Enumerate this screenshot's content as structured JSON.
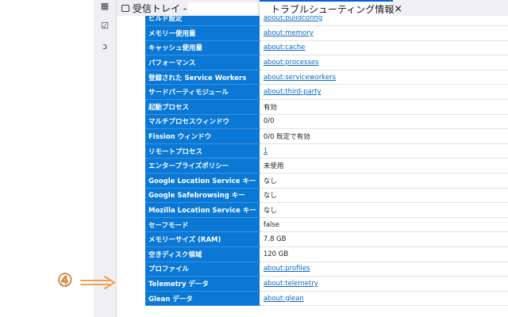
{
  "tabs": [
    {
      "title": "受信トレイ -",
      "icon": "mail-icon"
    },
    {
      "title": "トラブルシューティング情報",
      "icon": "firefox-icon",
      "close": "×"
    }
  ],
  "spaces_toolbar": [
    {
      "icon": "calendar-icon",
      "glyph": "▦"
    },
    {
      "icon": "tasks-icon",
      "glyph": "☑"
    },
    {
      "icon": "chat-icon",
      "glyph": "ↄ"
    }
  ],
  "rows": [
    {
      "key": "ビルド設定",
      "value": "about:buildconfig",
      "link": true
    },
    {
      "key": "メモリー使用量",
      "value": "about:memory",
      "link": true
    },
    {
      "key": "キャッシュ使用量",
      "value": "about:cache",
      "link": true
    },
    {
      "key": "パフォーマンス",
      "value": "about:processes",
      "link": true
    },
    {
      "key": "登録された Service Workers",
      "value": "about:serviceworkers",
      "link": true
    },
    {
      "key": "サードパーティモジュール",
      "value": "about:third-party",
      "link": true
    },
    {
      "key": "起動プロセス",
      "value": "有効",
      "link": false
    },
    {
      "key": "マルチプロセスウィンドウ",
      "value": "0/0",
      "link": false
    },
    {
      "key": "Fission ウィンドウ",
      "value": "0/0 既定で有効",
      "link": false
    },
    {
      "key": "リモートプロセス",
      "value": "1",
      "link": true
    },
    {
      "key": "エンタープライズポリシー",
      "value": "未使用",
      "link": false
    },
    {
      "key": "Google Location Service キー",
      "value": "なし",
      "link": false
    },
    {
      "key": "Google Safebrowsing キー",
      "value": "なし",
      "link": false
    },
    {
      "key": "Mozilla Location Service キー",
      "value": "なし",
      "link": false
    },
    {
      "key": "セーフモード",
      "value": "false",
      "link": false
    },
    {
      "key": "メモリーサイズ (RAM)",
      "value": "7.8 GB",
      "link": false
    },
    {
      "key": "空きディスク領域",
      "value": "120 GB",
      "link": false
    },
    {
      "key": "プロファイル",
      "value": "about:profiles",
      "link": true
    },
    {
      "key": "Telemetry データ",
      "value": "about:telemetry",
      "link": true
    },
    {
      "key": "Glean データ",
      "value": "about:glean",
      "link": true
    }
  ],
  "annotation": {
    "label": "④",
    "color": "#f0a050"
  }
}
